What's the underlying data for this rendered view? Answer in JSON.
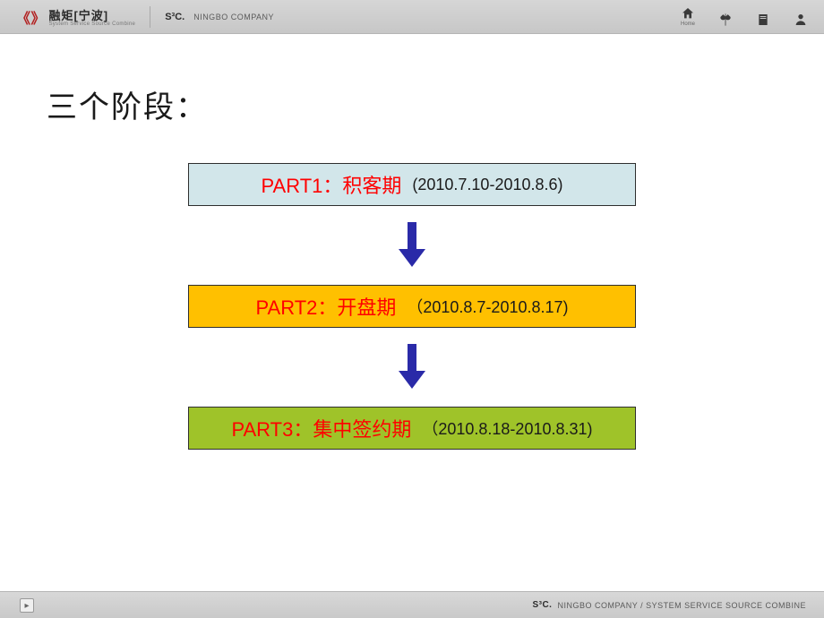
{
  "header": {
    "brand_glyph": "《 》",
    "brand_cn": "融矩[宁波]",
    "brand_sub": "System Service Source Combine",
    "ssc": "S³C.",
    "ssc_sub": "NINGBO COMPANY",
    "icons": [
      {
        "name": "home-icon",
        "label": "Home"
      },
      {
        "name": "balance-icon",
        "label": ""
      },
      {
        "name": "doc-icon",
        "label": ""
      },
      {
        "name": "person-icon",
        "label": ""
      }
    ]
  },
  "title": "三个阶段：",
  "stages": [
    {
      "label": "PART1：积客期",
      "date": "(2010.7.10-2010.8.6)"
    },
    {
      "label": "PART2：开盘期",
      "date": "（2010.8.7-2010.8.17)"
    },
    {
      "label": "PART3：集中签约期",
      "date": "（2010.8.18-2010.8.31)"
    }
  ],
  "footer": {
    "ssc": "S³C.",
    "text": "NINGBO COMPANY / SYSTEM SERVICE SOURCE COMBINE"
  }
}
